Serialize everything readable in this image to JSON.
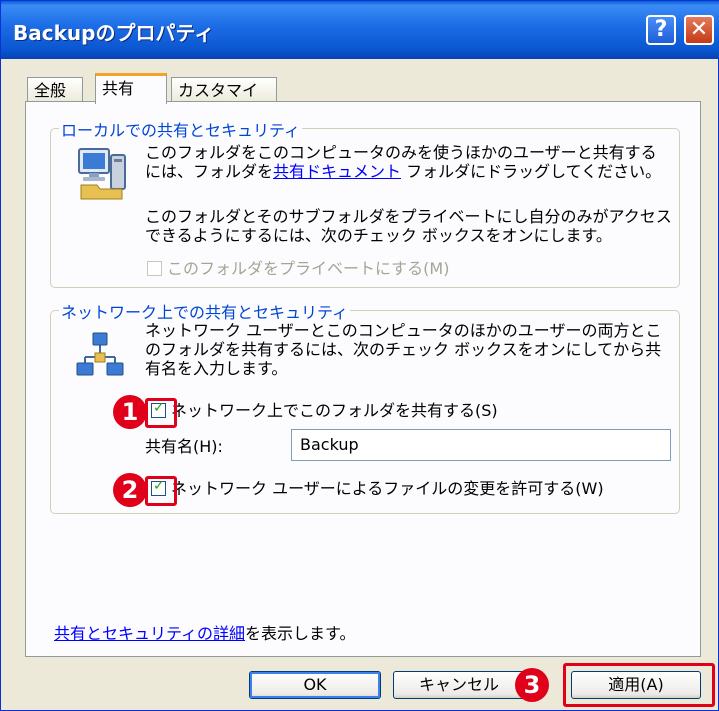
{
  "window": {
    "title": "Backupのプロパティ",
    "help_label": "?",
    "close_label": "✕"
  },
  "tabs": [
    {
      "label": "全般",
      "active": false
    },
    {
      "label": "共有",
      "active": true
    },
    {
      "label": "カスタマイズ",
      "active": false
    }
  ],
  "local": {
    "title": "ローカルでの共有とセキュリティ",
    "desc1_line1": "このフォルダをこのコンピュータのみを使うほかのユーザーと共有する",
    "desc1_line2_prefix": "には、フォルダを",
    "desc1_link": "共有ドキュメント",
    "desc1_line2_suffix": " フォルダにドラッグしてください。",
    "desc2_line1": "このフォルダとそのサブフォルダをプライベートにし自分のみがアクセス",
    "desc2_line2": "できるようにするには、次のチェック ボックスをオンにします。",
    "private_checkbox_label": "このフォルダをプライベートにする(M)",
    "private_checked": false
  },
  "network": {
    "title": "ネットワーク上での共有とセキュリティ",
    "desc_line1": "ネットワーク ユーザーとこのコンピュータのほかのユーザーの両方とこ",
    "desc_line2": "のフォルダを共有するには、次のチェック ボックスをオンにしてから共",
    "desc_line3": "有名を入力します。",
    "share_checkbox_label": "ネットワーク上でこのフォルダを共有する(S)",
    "share_checked": true,
    "share_name_label": "共有名(H):",
    "share_name_value": "Backup",
    "allow_change_label": "ネットワーク ユーザーによるファイルの変更を許可する(W)",
    "allow_change_checked": true
  },
  "details_link": "共有とセキュリティの詳細",
  "details_suffix": "を表示します。",
  "annotations": [
    "1",
    "2",
    "3"
  ],
  "buttons": {
    "ok": "OK",
    "cancel": "キャンセル",
    "apply": "適用(A)"
  },
  "colors": {
    "title_bar": "#0a55d0",
    "group_title": "#0046d5",
    "annotation_red": "#e0001a",
    "check_green": "#21a121"
  }
}
